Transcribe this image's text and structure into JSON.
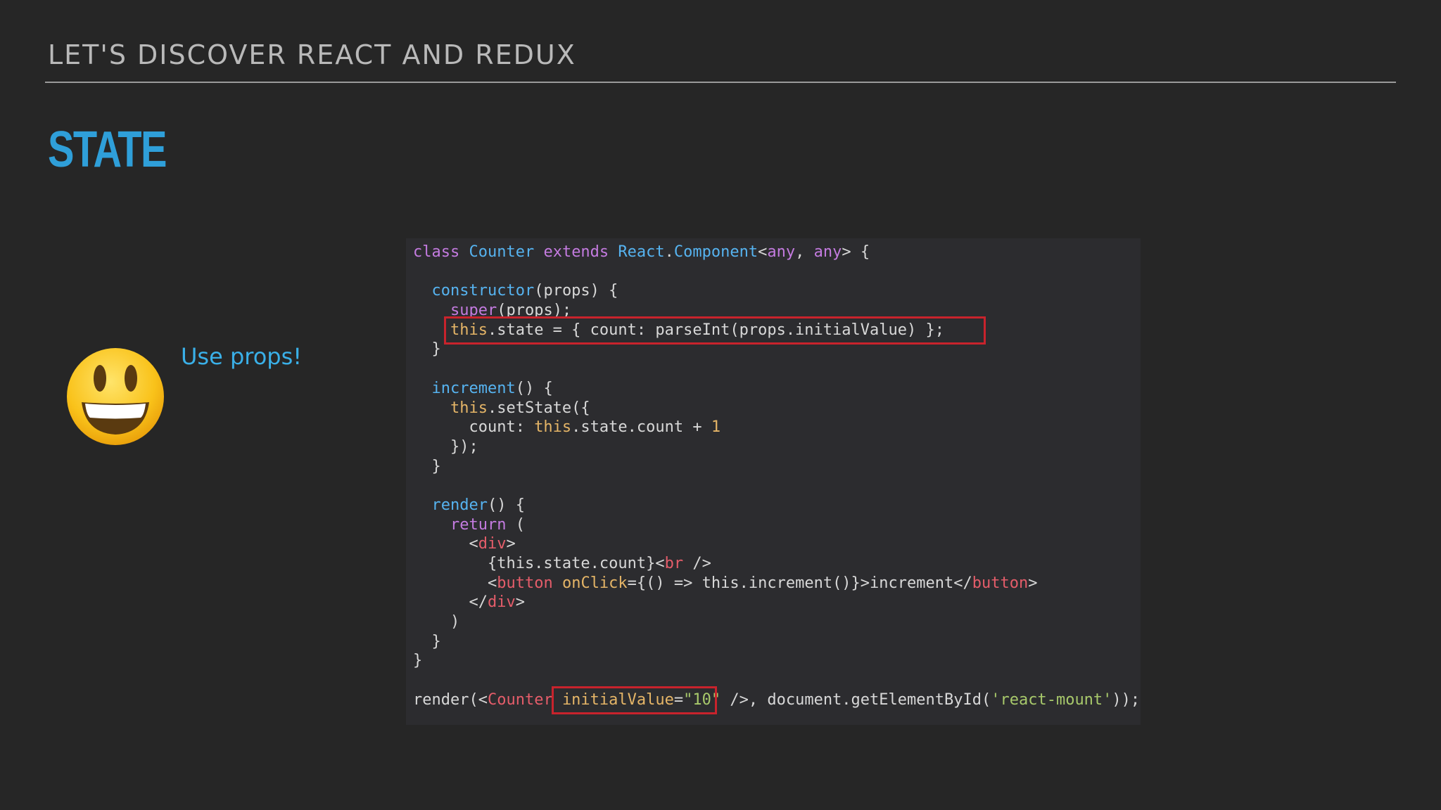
{
  "header": {
    "title": "LET'S DISCOVER REACT AND REDUX"
  },
  "slide": {
    "title": "STATE",
    "note": "Use props!",
    "emoji_icon": "smiley-face-icon"
  },
  "code": {
    "highlight_color": "#c8232c",
    "lines": [
      "class Counter extends React.Component<any, any> {",
      "",
      "  constructor(props) {",
      "    super(props);",
      "    this.state = { count: parseInt(props.initialValue) };",
      "  }",
      "",
      "  increment() {",
      "    this.setState({",
      "      count: this.state.count + 1",
      "    });",
      "  }",
      "",
      "  render() {",
      "    return (",
      "      <div>",
      "        {this.state.count}<br />",
      "        <button onClick={() => this.increment()}>increment</button>",
      "      </div>",
      "    )",
      "  }",
      "}",
      "",
      "render(<Counter initialValue=\"10\" />, document.getElementById('react-mount'));"
    ]
  }
}
